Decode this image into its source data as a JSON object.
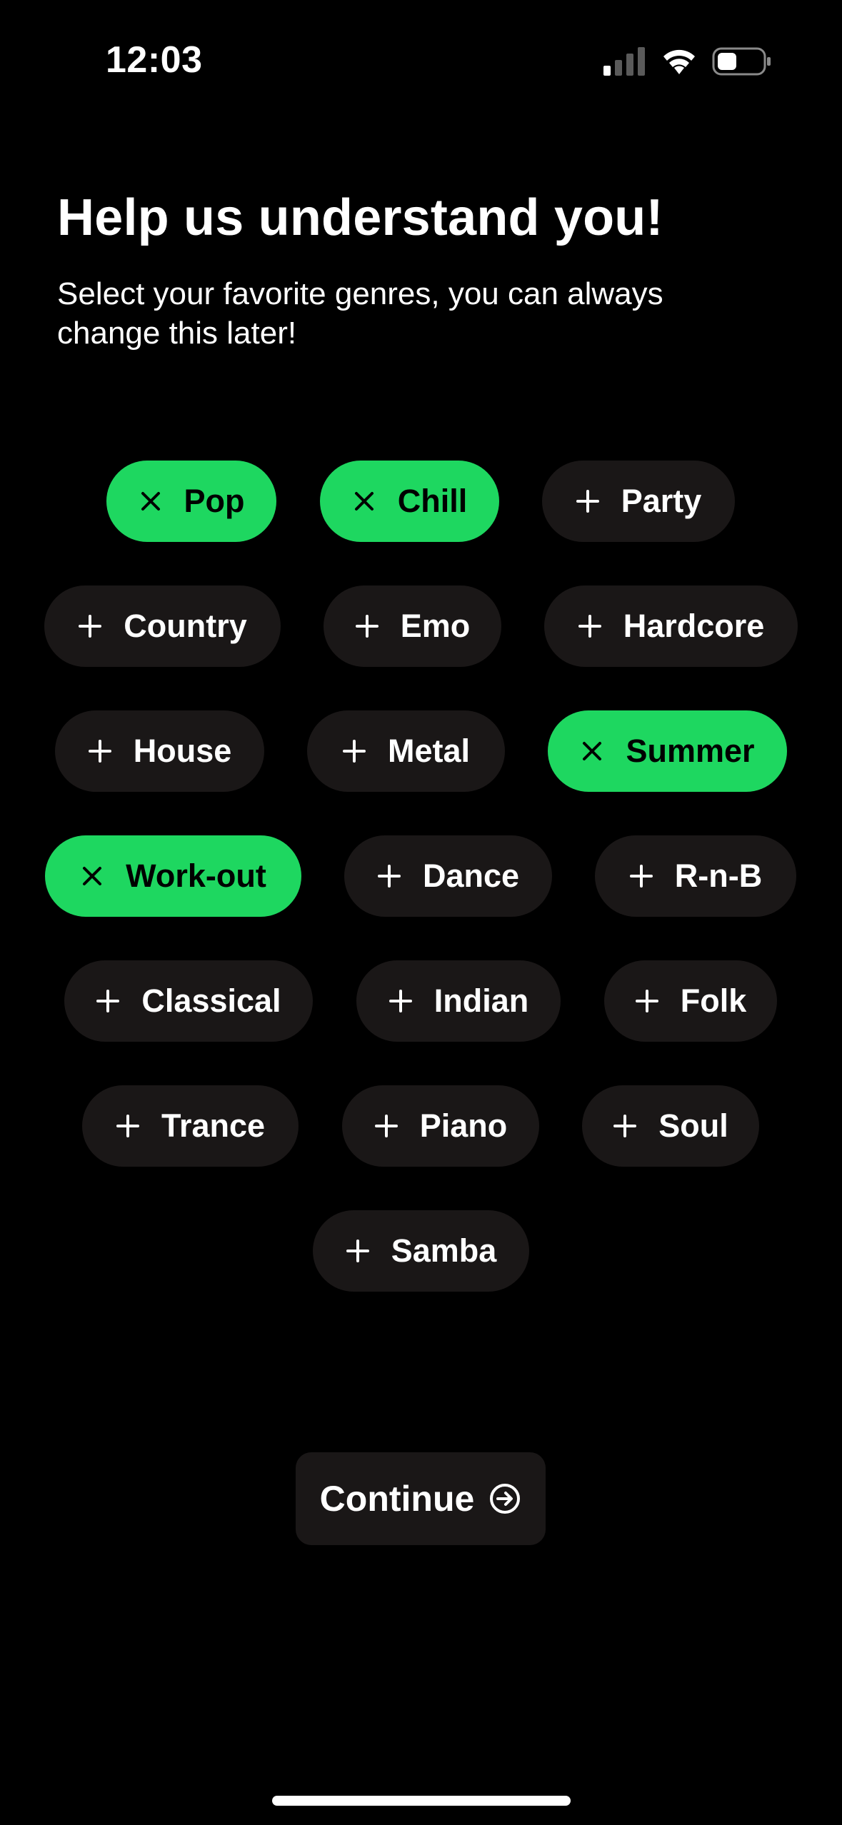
{
  "status_bar": {
    "time": "12:03"
  },
  "header": {
    "title": "Help us understand you!",
    "subtitle": "Select your favorite genres, you can always change this later!"
  },
  "colors": {
    "background": "#000000",
    "chip_default": "#1a1717",
    "chip_selected": "#1ed760",
    "text": "#ffffff",
    "text_selected": "#000000"
  },
  "genres": [
    {
      "label": "Pop",
      "selected": true,
      "icon": "close-icon"
    },
    {
      "label": "Chill",
      "selected": true,
      "icon": "close-icon"
    },
    {
      "label": "Party",
      "selected": false,
      "icon": "plus-icon"
    },
    {
      "label": "Country",
      "selected": false,
      "icon": "plus-icon"
    },
    {
      "label": "Emo",
      "selected": false,
      "icon": "plus-icon"
    },
    {
      "label": "Hardcore",
      "selected": false,
      "icon": "plus-icon"
    },
    {
      "label": "House",
      "selected": false,
      "icon": "plus-icon"
    },
    {
      "label": "Metal",
      "selected": false,
      "icon": "plus-icon"
    },
    {
      "label": "Summer",
      "selected": true,
      "icon": "close-icon"
    },
    {
      "label": "Work-out",
      "selected": true,
      "icon": "close-icon"
    },
    {
      "label": "Dance",
      "selected": false,
      "icon": "plus-icon"
    },
    {
      "label": "R-n-B",
      "selected": false,
      "icon": "plus-icon"
    },
    {
      "label": "Classical",
      "selected": false,
      "icon": "plus-icon"
    },
    {
      "label": "Indian",
      "selected": false,
      "icon": "plus-icon"
    },
    {
      "label": "Folk",
      "selected": false,
      "icon": "plus-icon"
    },
    {
      "label": "Trance",
      "selected": false,
      "icon": "plus-icon"
    },
    {
      "label": "Piano",
      "selected": false,
      "icon": "plus-icon"
    },
    {
      "label": "Soul",
      "selected": false,
      "icon": "plus-icon"
    },
    {
      "label": "Samba",
      "selected": false,
      "icon": "plus-icon"
    }
  ],
  "continue_button": {
    "label": "Continue",
    "icon": "arrow-right-circle-icon"
  }
}
